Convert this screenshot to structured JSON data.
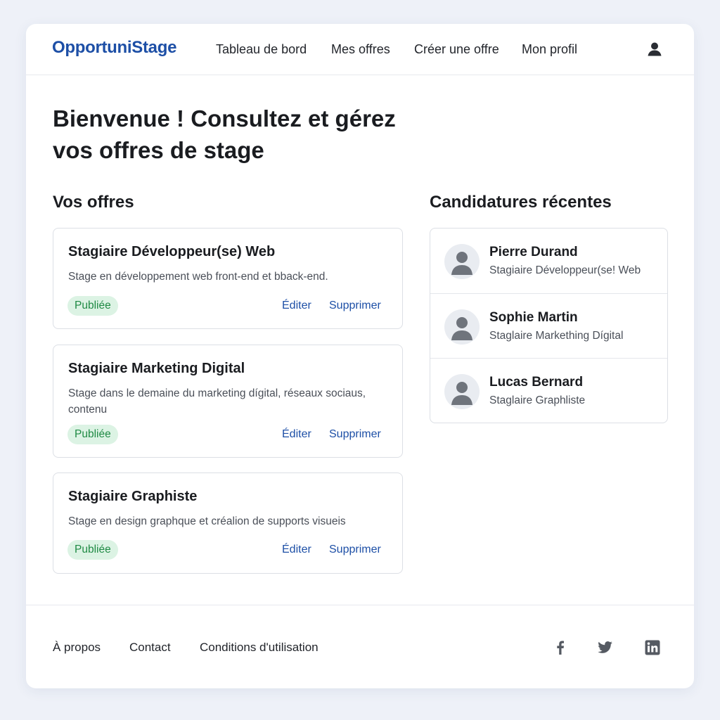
{
  "header": {
    "brand": "OpportuniStage",
    "nav": [
      "Tableau de bord",
      "Mes offres",
      "Créer une offre",
      "Mon profil"
    ],
    "user_icon": "user-icon"
  },
  "main": {
    "title": "Bienvenue ! Consultez et gérez vos offres de stage",
    "offers_heading": "Vos offres",
    "candidates_heading": "Candidatures récentes",
    "offers": [
      {
        "title": "Stagiaire Développeur(se) Web",
        "description": "Stage en développement web front-end et bback-end.",
        "status": "Publiée",
        "edit": "Éditer",
        "delete": "Supprimer"
      },
      {
        "title": "Stagiaire Marketing Digital",
        "description": "Stage dans le demaine du marketing dígital, réseaux sociaus, contenu",
        "status": "Publiée",
        "edit": "Éditer",
        "delete": "Supprimer"
      },
      {
        "title": "Stagiaire Graphiste",
        "description": "Stage en design graphque et créalion de supports visueis",
        "status": "Publiée",
        "edit": "Éditer",
        "delete": "Supprimer"
      }
    ],
    "candidates": [
      {
        "name": "Pierre Durand",
        "role": "Stagiaire Développeur(se! Web"
      },
      {
        "name": "Sophie Martin",
        "role": "Staglaire Markething Dígital"
      },
      {
        "name": "Lucas Bernard",
        "role": "Staglaire Graphliste"
      }
    ]
  },
  "footer": {
    "links": [
      "À propos",
      "Contact",
      "Conditions d'utilisation"
    ],
    "social": [
      "facebook-icon",
      "twitter-icon",
      "linkedin-icon"
    ]
  },
  "colors": {
    "brand": "#1d4fa6",
    "badge_bg": "#dcf3e4",
    "badge_text": "#1f8a44",
    "page_bg": "#eef1f8"
  }
}
